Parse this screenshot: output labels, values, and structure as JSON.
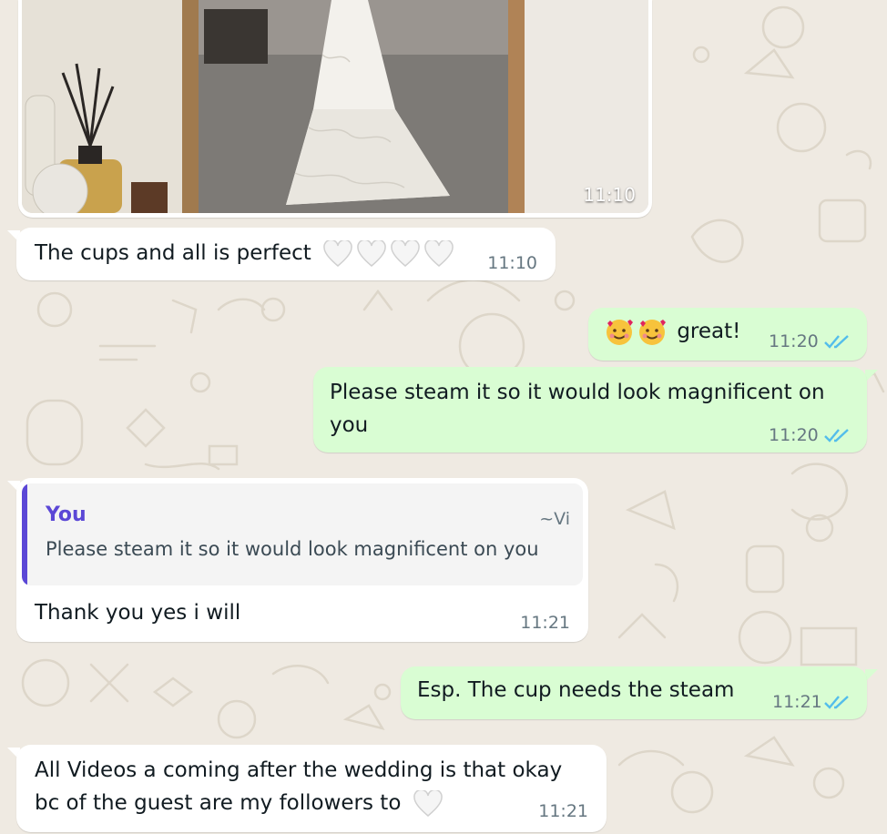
{
  "photo_message": {
    "time": "11:10"
  },
  "messages": [
    {
      "text": "The cups and all is perfect",
      "time": "11:10",
      "hearts": 4
    },
    {
      "text": "great!",
      "time": "11:20",
      "emoji": "smiling-face-with-hearts",
      "emoji_count": 2
    },
    {
      "line1": "Please steam it so it would look magnificent on",
      "line2": "you",
      "time": "11:20"
    },
    {
      "reply_author": "You",
      "reply_handle": "~Vi",
      "reply_text": "Please steam it so it would look magnificent on you",
      "text": "Thank you yes i will",
      "time": "11:21"
    },
    {
      "text": "Esp. The cup needs the steam",
      "time": "11:21"
    },
    {
      "line1": "All Videos a coming after the wedding is that okay",
      "line2": "bc of the guest are my followers to",
      "time": "11:21",
      "hearts": 1
    }
  ],
  "colors": {
    "incoming": "#ffffff",
    "outgoing": "#d9fdd3",
    "read_ticks": "#53bdeb",
    "reply_accent": "#5b47d6",
    "wallpaper": "#efeae2"
  }
}
